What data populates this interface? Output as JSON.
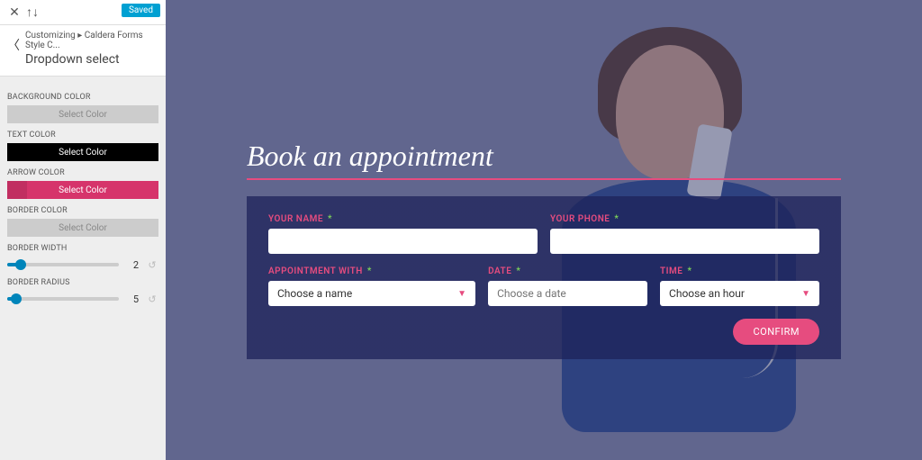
{
  "sidebar": {
    "saved_badge": "Saved",
    "breadcrumb_prefix": "Customizing ▸",
    "breadcrumb_section": "Caldera Forms Style C...",
    "title": "Dropdown select",
    "controls": {
      "bg_color": {
        "label": "BACKGROUND COLOR",
        "button": "Select Color"
      },
      "text_color": {
        "label": "TEXT COLOR",
        "button": "Select Color"
      },
      "arrow_color": {
        "label": "ARROW COLOR",
        "button": "Select Color"
      },
      "border_color": {
        "label": "BORDER COLOR",
        "button": "Select Color"
      },
      "border_width": {
        "label": "BORDER WIDTH",
        "value": "2"
      },
      "border_radius": {
        "label": "BORDER RADIUS",
        "value": "5"
      }
    }
  },
  "colors": {
    "accent_pink": "#e64c7f",
    "panel_overlay": "rgba(30,35,90,0.75)"
  },
  "form": {
    "heading": "Book an appointment",
    "fields": {
      "name": {
        "label": "YOUR NAME",
        "value": ""
      },
      "phone": {
        "label": "YOUR PHONE",
        "value": ""
      },
      "appt_with": {
        "label": "APPOINTMENT WITH",
        "placeholder": "Choose a name"
      },
      "date": {
        "label": "DATE",
        "placeholder": "Choose a date"
      },
      "time": {
        "label": "TIME",
        "placeholder": "Choose an hour"
      }
    },
    "confirm": "CONFIRM"
  }
}
